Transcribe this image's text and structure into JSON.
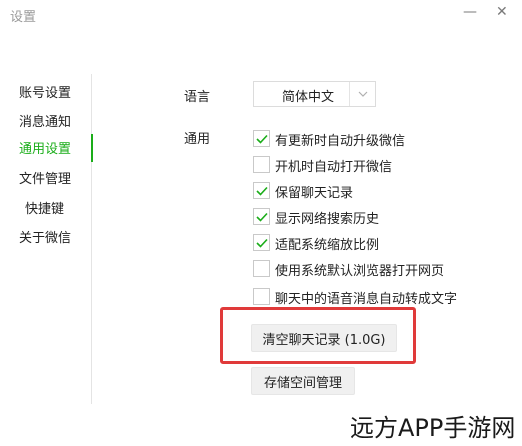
{
  "window": {
    "title": "设置",
    "minimize_symbol": "—",
    "close_symbol": "✕"
  },
  "sidebar": {
    "items": [
      {
        "label": "账号设置",
        "active": false
      },
      {
        "label": "消息通知",
        "active": false
      },
      {
        "label": "通用设置",
        "active": true
      },
      {
        "label": "文件管理",
        "active": false
      },
      {
        "label": "快捷键",
        "active": false
      },
      {
        "label": "关于微信",
        "active": false
      }
    ]
  },
  "main": {
    "language_label": "语言",
    "language_value": "简体中文",
    "general_label": "通用",
    "options": [
      {
        "label": "有更新时自动升级微信",
        "checked": true
      },
      {
        "label": "开机时自动打开微信",
        "checked": false
      },
      {
        "label": "保留聊天记录",
        "checked": true
      },
      {
        "label": "显示网络搜索历史",
        "checked": true
      },
      {
        "label": "适配系统缩放比例",
        "checked": true
      },
      {
        "label": "使用系统默认浏览器打开网页",
        "checked": false
      },
      {
        "label": "聊天中的语音消息自动转成文字",
        "checked": false
      }
    ],
    "clear_history_button": "清空聊天记录 (1.0G)",
    "storage_button": "存储空间管理"
  },
  "watermark": "远方APP手游网",
  "colors": {
    "accent": "#1aad19",
    "highlight": "#e03a3a",
    "button_bg": "#f0f0f0"
  },
  "icons": {
    "checkbox_checked": "check-icon",
    "select_arrow": "chevron-down-icon"
  }
}
